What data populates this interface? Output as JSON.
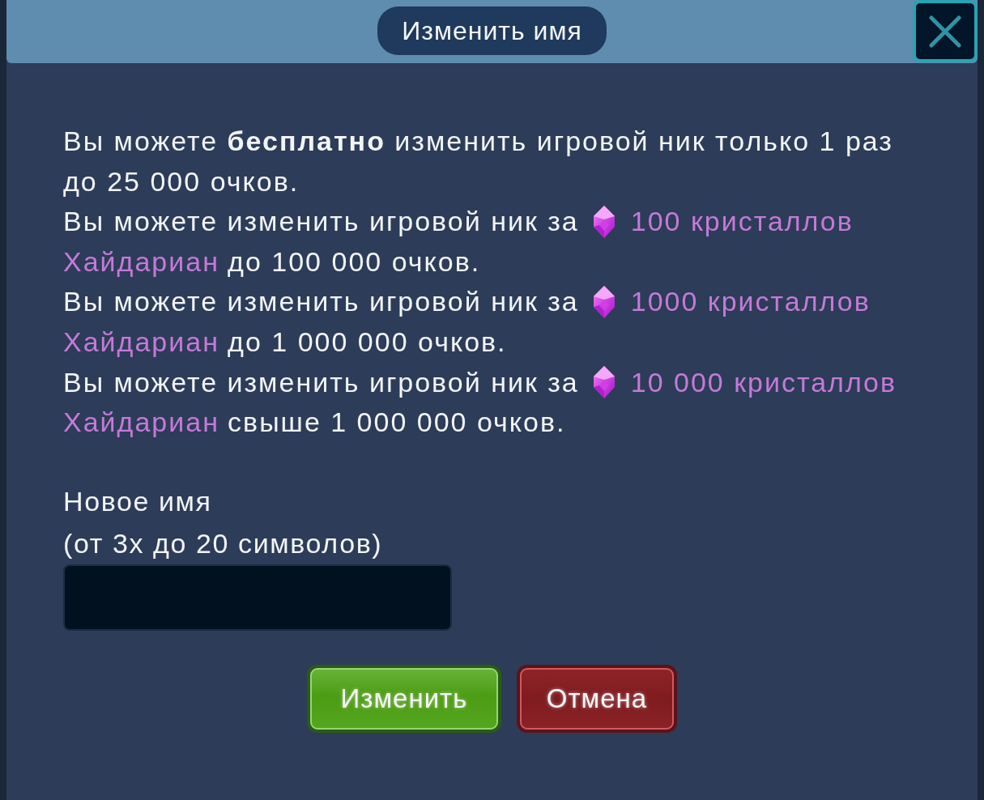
{
  "dialog": {
    "title": "Изменить имя"
  },
  "rules": [
    {
      "kind": "free",
      "text": "Вы можете **бесплатно** изменить игровой ник только 1 раз до 25 000 очков."
    },
    {
      "kind": "paid",
      "before": "Вы можете изменить игровой ник за",
      "price": "100 кристаллов",
      "currency": "Хайдариан",
      "after": "до 100 000 очков."
    },
    {
      "kind": "paid",
      "before": "Вы можете изменить игровой ник за",
      "price": "1000 кристаллов",
      "currency": "Хайдариан",
      "after": "до 1 000 000 очков."
    },
    {
      "kind": "paid",
      "before": "Вы можете изменить игровой ник за",
      "price": "10 000 кристаллов",
      "currency": "Хайдариан",
      "after": "свыше 1 000 000 очков."
    }
  ],
  "name_field": {
    "label": "Новое имя",
    "hint": "(от 3х до 20 символов)"
  },
  "buttons": [
    {
      "kind": "confirm",
      "label": "Изменить"
    },
    {
      "kind": "cancel",
      "label": "Отмена"
    }
  ]
}
